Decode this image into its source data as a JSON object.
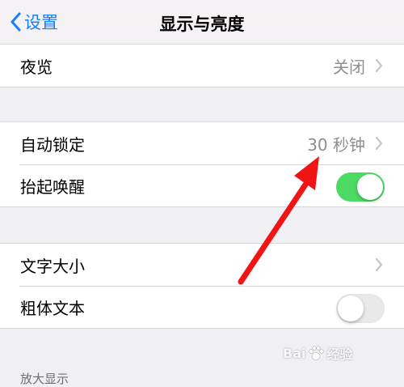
{
  "navbar": {
    "back_label": "设置",
    "title": "显示与亮度"
  },
  "groups": {
    "night": {
      "night_shift": {
        "label": "夜览",
        "value": "关闭"
      }
    },
    "lock": {
      "auto_lock": {
        "label": "自动锁定",
        "value": "30 秒钟"
      },
      "raise_to_wake": {
        "label": "抬起唤醒",
        "state": "on"
      }
    },
    "text": {
      "text_size": {
        "label": "文字大小"
      },
      "bold_text": {
        "label": "粗体文本",
        "state": "off"
      }
    }
  },
  "section_header": "放大显示",
  "watermark": {
    "brand_left": "Bai",
    "brand_right": "经验"
  },
  "colors": {
    "accent": "#157efb",
    "toggle_on": "#4cd964",
    "annotation_arrow": "#f01414"
  }
}
